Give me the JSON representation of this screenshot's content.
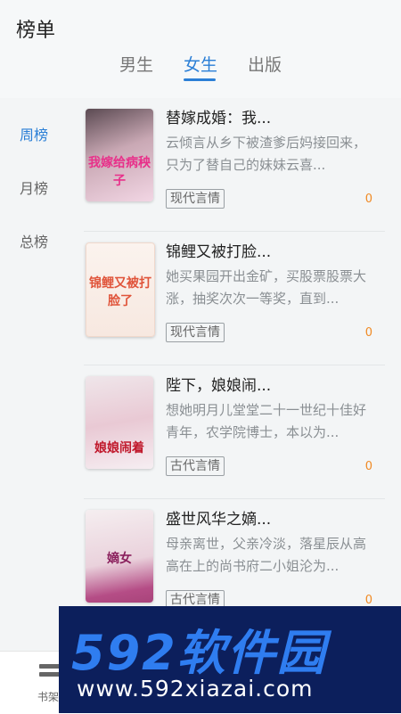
{
  "header": {
    "title": "榜单"
  },
  "tabs": [
    {
      "label": "男生",
      "active": false
    },
    {
      "label": "女生",
      "active": true
    },
    {
      "label": "出版",
      "active": false
    }
  ],
  "sidebar": {
    "items": [
      {
        "label": "周榜",
        "active": true
      },
      {
        "label": "月榜",
        "active": false
      },
      {
        "label": "总榜",
        "active": false
      }
    ]
  },
  "books": [
    {
      "title": "替嫁成婚：我...",
      "desc": "云倾言从乡下被渣爹后妈接回来，只为了替自己的妹妹云喜...",
      "tag": "现代言情",
      "count": "0",
      "cover_text": "我嫁给病秧子"
    },
    {
      "title": "锦鲤又被打脸...",
      "desc": "她买果园开出金矿，买股票股票大涨，抽奖次次一等奖，直到...",
      "tag": "现代言情",
      "count": "0",
      "cover_text": "锦鲤又被打脸了"
    },
    {
      "title": "陛下，娘娘闹...",
      "desc": "想她明月儿堂堂二十一世纪十佳好青年，农学院博士，本以为...",
      "tag": "古代言情",
      "count": "0",
      "cover_text": "娘娘闹着"
    },
    {
      "title": "盛世风华之嫡...",
      "desc": "母亲离世，父亲冷淡，落星辰从高高在上的尚书府二小姐沦为...",
      "tag": "古代言情",
      "count": "0",
      "cover_text": "嫡女"
    }
  ],
  "bottom_nav": {
    "shelf_label": "书架"
  },
  "watermark": {
    "logo": "592软件园",
    "url": "www.592xiazai.com"
  },
  "colors": {
    "accent": "#2b7fd6",
    "count": "#f08a24"
  }
}
